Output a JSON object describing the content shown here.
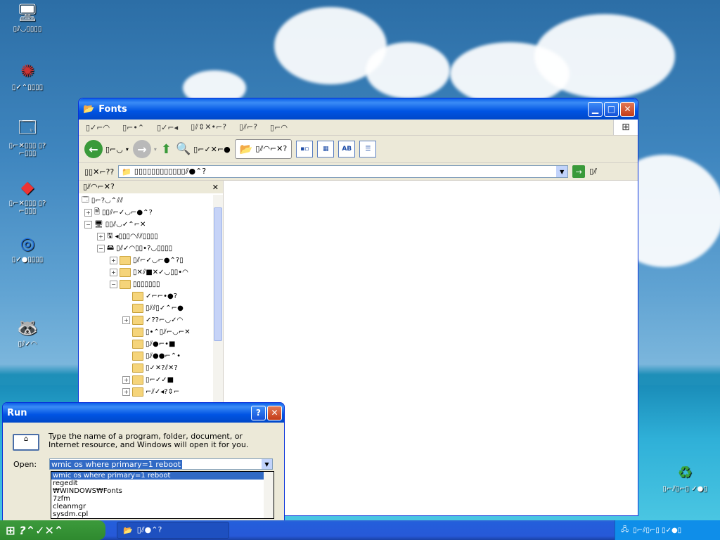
{
  "desktop": {
    "icons": [
      {
        "name": "desktop-icon-computer",
        "label": "▯⫽◡▯▯▯▯",
        "glyph": "🖥"
      },
      {
        "name": "desktop-icon-app1",
        "label": "▯✓⌃▯▯▯▯",
        "glyph": "✺"
      },
      {
        "name": "desktop-icon-app2",
        "label": "▯⌐✕▯▯▯ ▯?⌐▯▯▯",
        "glyph": "🗔"
      },
      {
        "name": "desktop-icon-app3",
        "label": "▯⌐✕▯▯▯ ▯?⌐▯▯▯",
        "glyph": "◆"
      },
      {
        "name": "desktop-icon-app4",
        "label": "▯✓●▯▯▯▯",
        "glyph": "◎"
      },
      {
        "name": "desktop-icon-app5",
        "label": "▯⫽✓◠",
        "glyph": "🦝"
      },
      {
        "name": "desktop-icon-recycle",
        "label": "▯⌐⫽▯⌐▯ ✓●▯",
        "glyph": "♻"
      }
    ]
  },
  "fonts_window": {
    "title": "Fonts",
    "menu": [
      "▯✓⌐◠",
      "▯⌐•⌃",
      "▯✓⌐◂",
      "▯⫽⇕✕•⌐?",
      "▯⫽⌐?",
      "▯⌐◠"
    ],
    "toolbar": {
      "back_label": "▯⌐◡",
      "search_label": "▯⌐✓✕⌐●",
      "folders_label": "▯⫽◠⌐✕?"
    },
    "address": {
      "label": "▯▯✕⌐??",
      "value": "▯▯▯▯▯▯▯▯▯▯▯▯⫽●⌃?",
      "go_label": "▯⫽"
    },
    "left_pane": {
      "header": "▯⫽◠⌐✕?",
      "close": "✕",
      "tree": [
        {
          "indent": 0,
          "exp": "",
          "label": "▯⌐?◡⌃⫽⫽"
        },
        {
          "indent": 1,
          "exp": "+",
          "label": "▯▯⫽⌐✓◡⌐●⌃?"
        },
        {
          "indent": 1,
          "exp": "−",
          "label": "▯▯⫽◡✓⌃⌐✕"
        },
        {
          "indent": 2,
          "exp": "+",
          "label": "◂▯▯▯◠⫽⫽▯▯▯▯"
        },
        {
          "indent": 2,
          "exp": "−",
          "label": "▯⫽✓◠▯▯•?◡▯▯▯▯"
        },
        {
          "indent": 3,
          "exp": "+",
          "label": "▯⫽⌐✓◡⌐●⌃?▯"
        },
        {
          "indent": 3,
          "exp": "+",
          "label": "▯✕⫽■✕✓◡▯▯•◠"
        },
        {
          "indent": 3,
          "exp": "−",
          "label": "▯▯▯▯▯▯▯"
        },
        {
          "indent": 4,
          "exp": "",
          "label": "✓⌐⌐•●?"
        },
        {
          "indent": 4,
          "exp": "",
          "label": "▯⫽⫽▯✓⌃⌐●"
        },
        {
          "indent": 4,
          "exp": "+",
          "label": "✓??⌐◡✓◠"
        },
        {
          "indent": 4,
          "exp": "",
          "label": "▯•⌃▯⫽⌐◡⌐✕"
        },
        {
          "indent": 4,
          "exp": "",
          "label": "▯⫽●⌐•■"
        },
        {
          "indent": 4,
          "exp": "",
          "label": "▯⫽●●⌐⌃•"
        },
        {
          "indent": 4,
          "exp": "",
          "label": "▯✓✕?⫽✕?"
        },
        {
          "indent": 4,
          "exp": "+",
          "label": "▯⌐✓✓■"
        },
        {
          "indent": 4,
          "exp": "+",
          "label": "⌐⫽✓◂?⇕⌐"
        }
      ]
    }
  },
  "run_dialog": {
    "title": "Run",
    "description": "Type the name of a program, folder, document, or Internet resource, and Windows will open it for you.",
    "open_label": "Open:",
    "open_value": "wmic os where primary=1 reboot",
    "history": [
      "wmic os where primary=1 reboot",
      "regedit",
      "₩WINDOWS₩Fonts",
      "7zfm",
      "cleanmgr",
      "sysdm.cpl"
    ]
  },
  "taskbar": {
    "start_label": "?⌃✓✕⌃",
    "task_label": "▯⫽●⌃?",
    "tray_label": "▯⌐⫽▯⌐▯ ▯✓●▯"
  }
}
